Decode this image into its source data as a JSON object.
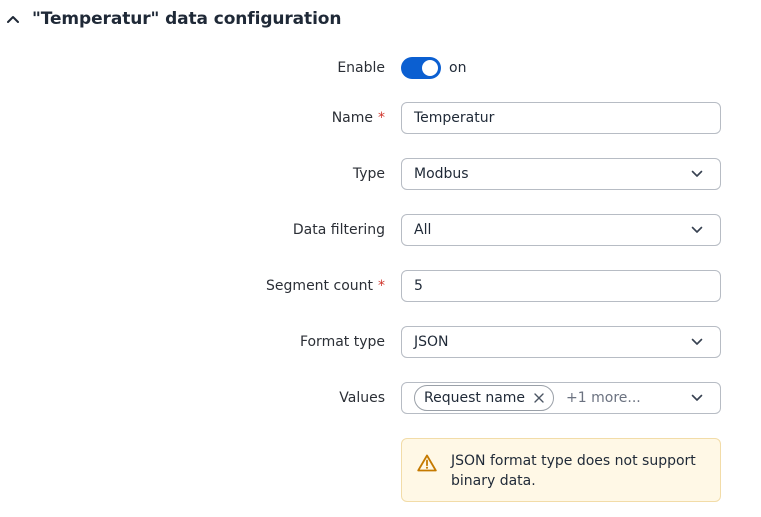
{
  "section": {
    "title": "\"Temperatur\" data configuration"
  },
  "fields": {
    "enable": {
      "label": "Enable",
      "state": "on"
    },
    "name": {
      "label": "Name",
      "required_mark": "*",
      "value": "Temperatur"
    },
    "type": {
      "label": "Type",
      "value": "Modbus"
    },
    "data_filtering": {
      "label": "Data filtering",
      "value": "All"
    },
    "segment_count": {
      "label": "Segment count",
      "required_mark": "*",
      "value": "5"
    },
    "format_type": {
      "label": "Format type",
      "value": "JSON"
    },
    "values": {
      "label": "Values",
      "chip": "Request name",
      "more": "+1 more..."
    }
  },
  "alert": {
    "text": "JSON format type does not support binary data."
  },
  "colors": {
    "accent": "#0b5fd1",
    "required": "#d0352c",
    "warning_bg": "#fff8e6",
    "warning_icon": "#c57a00"
  },
  "icons": [
    "chevron-up-icon",
    "chevron-down-icon",
    "close-icon",
    "warning-icon"
  ]
}
